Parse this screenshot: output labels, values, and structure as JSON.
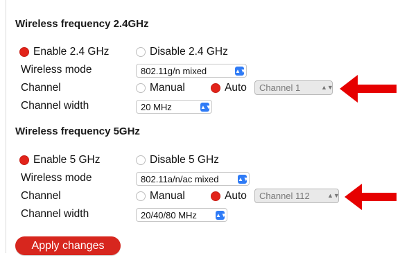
{
  "accent_color": "#e2231a",
  "band_24": {
    "title": "Wireless frequency 2.4GHz",
    "enable_label": "Enable 2.4 GHz",
    "disable_label": "Disable 2.4 GHz",
    "enabled": true,
    "mode_label": "Wireless mode",
    "mode_value": "802.11g/n mixed",
    "channel_label": "Channel",
    "manual_label": "Manual",
    "auto_label": "Auto",
    "channel_mode": "Auto",
    "channel_value": "Channel 1",
    "width_label": "Channel width",
    "width_value": "20 MHz"
  },
  "band_5": {
    "title": "Wireless frequency 5GHz",
    "enable_label": "Enable 5 GHz",
    "disable_label": "Disable 5 GHz",
    "enabled": true,
    "mode_label": "Wireless mode",
    "mode_value": "802.11a/n/ac mixed",
    "channel_label": "Channel",
    "manual_label": "Manual",
    "auto_label": "Auto",
    "channel_mode": "Auto",
    "channel_value": "Channel 112",
    "width_label": "Channel width",
    "width_value": "20/40/80 MHz"
  },
  "apply_label": "Apply changes",
  "icons": {
    "dropdown": "chevron-up-down-icon",
    "annotation": "arrow-left-icon"
  }
}
